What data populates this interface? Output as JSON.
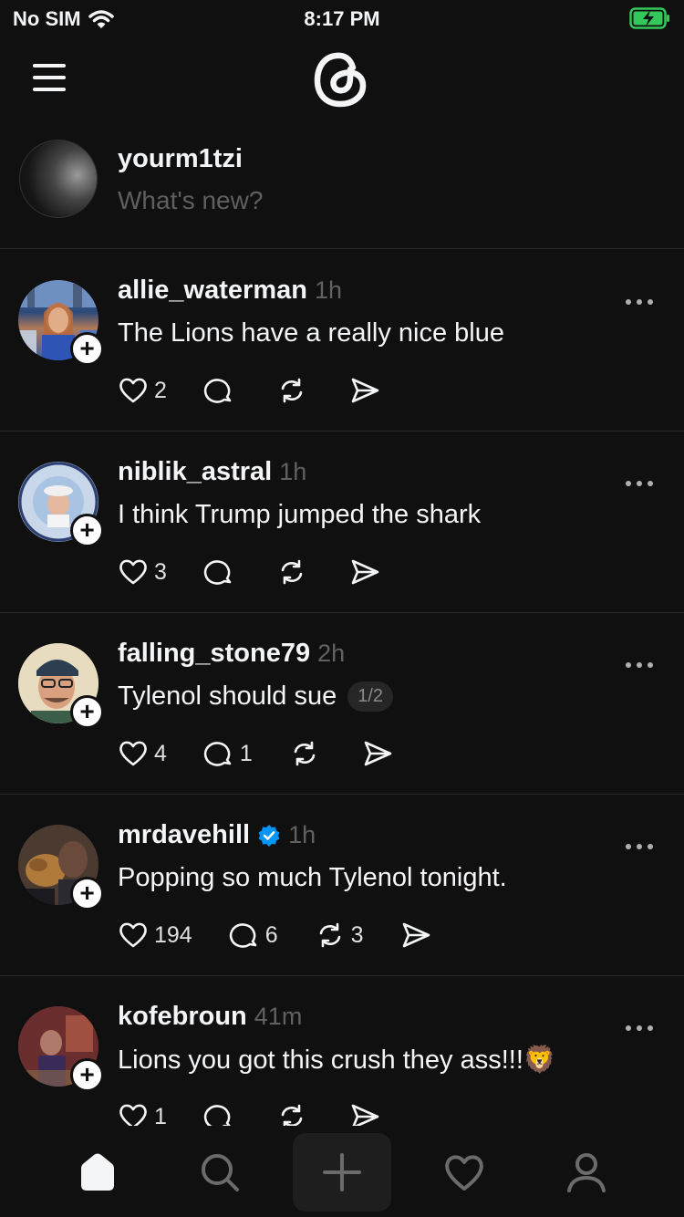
{
  "status_bar": {
    "carrier": "No SIM",
    "time": "8:17 PM"
  },
  "composer": {
    "username": "yourm1tzi",
    "placeholder": "What's new?"
  },
  "posts": [
    {
      "username": "allie_waterman",
      "time": "1h",
      "text": "The Lions have a really nice blue",
      "likes": "2",
      "replies": "",
      "reposts": "",
      "verified": false,
      "pager": ""
    },
    {
      "username": "niblik_astral",
      "time": "1h",
      "text": "I think Trump jumped the shark",
      "likes": "3",
      "replies": "",
      "reposts": "",
      "verified": false,
      "pager": ""
    },
    {
      "username": "falling_stone79",
      "time": "2h",
      "text": "Tylenol should sue",
      "likes": "4",
      "replies": "1",
      "reposts": "",
      "verified": false,
      "pager": "1/2"
    },
    {
      "username": "mrdavehill",
      "time": "1h",
      "text": "Popping so much Tylenol tonight.",
      "likes": "194",
      "replies": "6",
      "reposts": "3",
      "verified": true,
      "pager": ""
    },
    {
      "username": "kofebroun",
      "time": "41m",
      "text": "Lions you got this crush they ass!!!🦁",
      "likes": "1",
      "replies": "",
      "reposts": "",
      "verified": false,
      "pager": ""
    }
  ],
  "colors": {
    "background": "#101010",
    "text": "#f3f5f7",
    "muted": "#616161",
    "verified": "#0095f6"
  },
  "icons": {
    "home": "home-icon",
    "search": "search-icon",
    "compose": "plus-icon",
    "activity": "heart-icon",
    "profile": "profile-icon"
  }
}
